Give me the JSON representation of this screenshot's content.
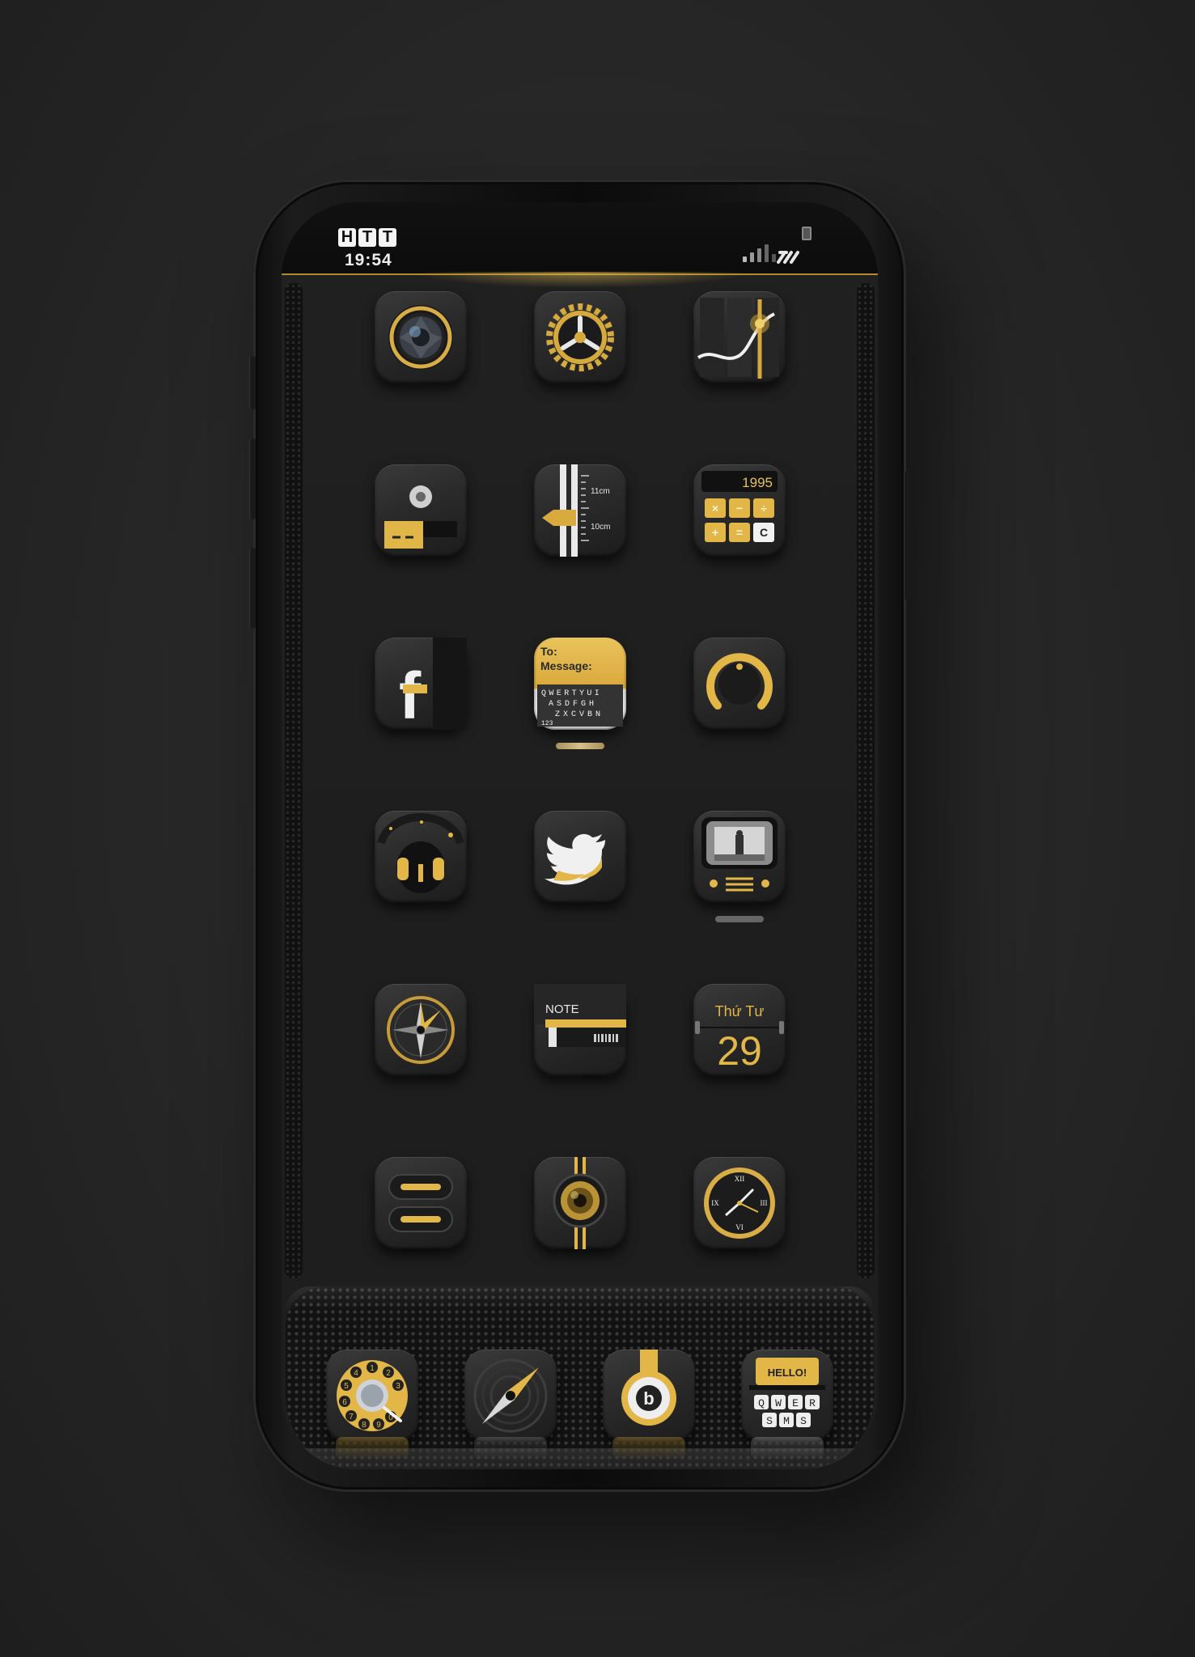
{
  "status_bar": {
    "carrier_letters": [
      "H",
      "T",
      "T"
    ],
    "time": "19:54"
  },
  "apps": [
    {
      "name": "camera-app",
      "icon": "camera-aperture-icon"
    },
    {
      "name": "settings-app",
      "icon": "gear-icon"
    },
    {
      "name": "stocks-app",
      "icon": "stocks-chart-icon"
    },
    {
      "name": "photos-app",
      "icon": "cassette-disc-icon"
    },
    {
      "name": "ruler-app",
      "icon": "ruler-icon",
      "labels": [
        "11cm",
        "10cm"
      ]
    },
    {
      "name": "calculator-app",
      "icon": "calculator-icon",
      "display": "1995",
      "keys": [
        "×",
        "−",
        "÷",
        "+",
        "=",
        "C"
      ]
    },
    {
      "name": "facebook-app",
      "icon": "facebook-f-icon",
      "letter": "f"
    },
    {
      "name": "messages-app",
      "icon": "message-keyboard-icon",
      "to_label": "To:",
      "message_label": "Message:",
      "kb_rows": [
        "QWERTYUI",
        "ASDFGH",
        "ZXCVBN"
      ],
      "kb_num": "123"
    },
    {
      "name": "volume-app",
      "icon": "knob-icon"
    },
    {
      "name": "music-app",
      "icon": "headphones-face-icon"
    },
    {
      "name": "twitter-app",
      "icon": "twitter-bird-icon"
    },
    {
      "name": "tv-app",
      "icon": "retro-tv-icon"
    },
    {
      "name": "compass-app",
      "icon": "compass-icon"
    },
    {
      "name": "notes-app",
      "icon": "note-pad-icon",
      "label": "NOTE"
    },
    {
      "name": "calendar-app",
      "icon": "calendar-icon",
      "weekday": "Thứ Tư",
      "day": "29"
    },
    {
      "name": "reminders-app",
      "icon": "toggle-bars-icon"
    },
    {
      "name": "speaker-app",
      "icon": "speaker-icon"
    },
    {
      "name": "clock-app",
      "icon": "clock-icon",
      "numerals": [
        "XII",
        "III",
        "VI",
        "IX"
      ]
    }
  ],
  "dock": [
    {
      "name": "phone-app",
      "icon": "rotary-dial-icon",
      "digits": [
        "1",
        "2",
        "3",
        "4",
        "5",
        "6",
        "7",
        "8",
        "9",
        "0"
      ]
    },
    {
      "name": "safari-app",
      "icon": "compass-needle-icon"
    },
    {
      "name": "beats-app",
      "icon": "beats-headphones-icon",
      "letter": "b"
    },
    {
      "name": "sms-app",
      "icon": "sms-keyboard-icon",
      "greeting": "HELLO!",
      "row1": [
        "Q",
        "W",
        "E",
        "R"
      ],
      "row2": [
        "S",
        "M",
        "S"
      ]
    }
  ],
  "colors": {
    "gold": "#e2b647",
    "gold_dark": "#a8812a",
    "icon_bg": "#2a2a2a"
  }
}
